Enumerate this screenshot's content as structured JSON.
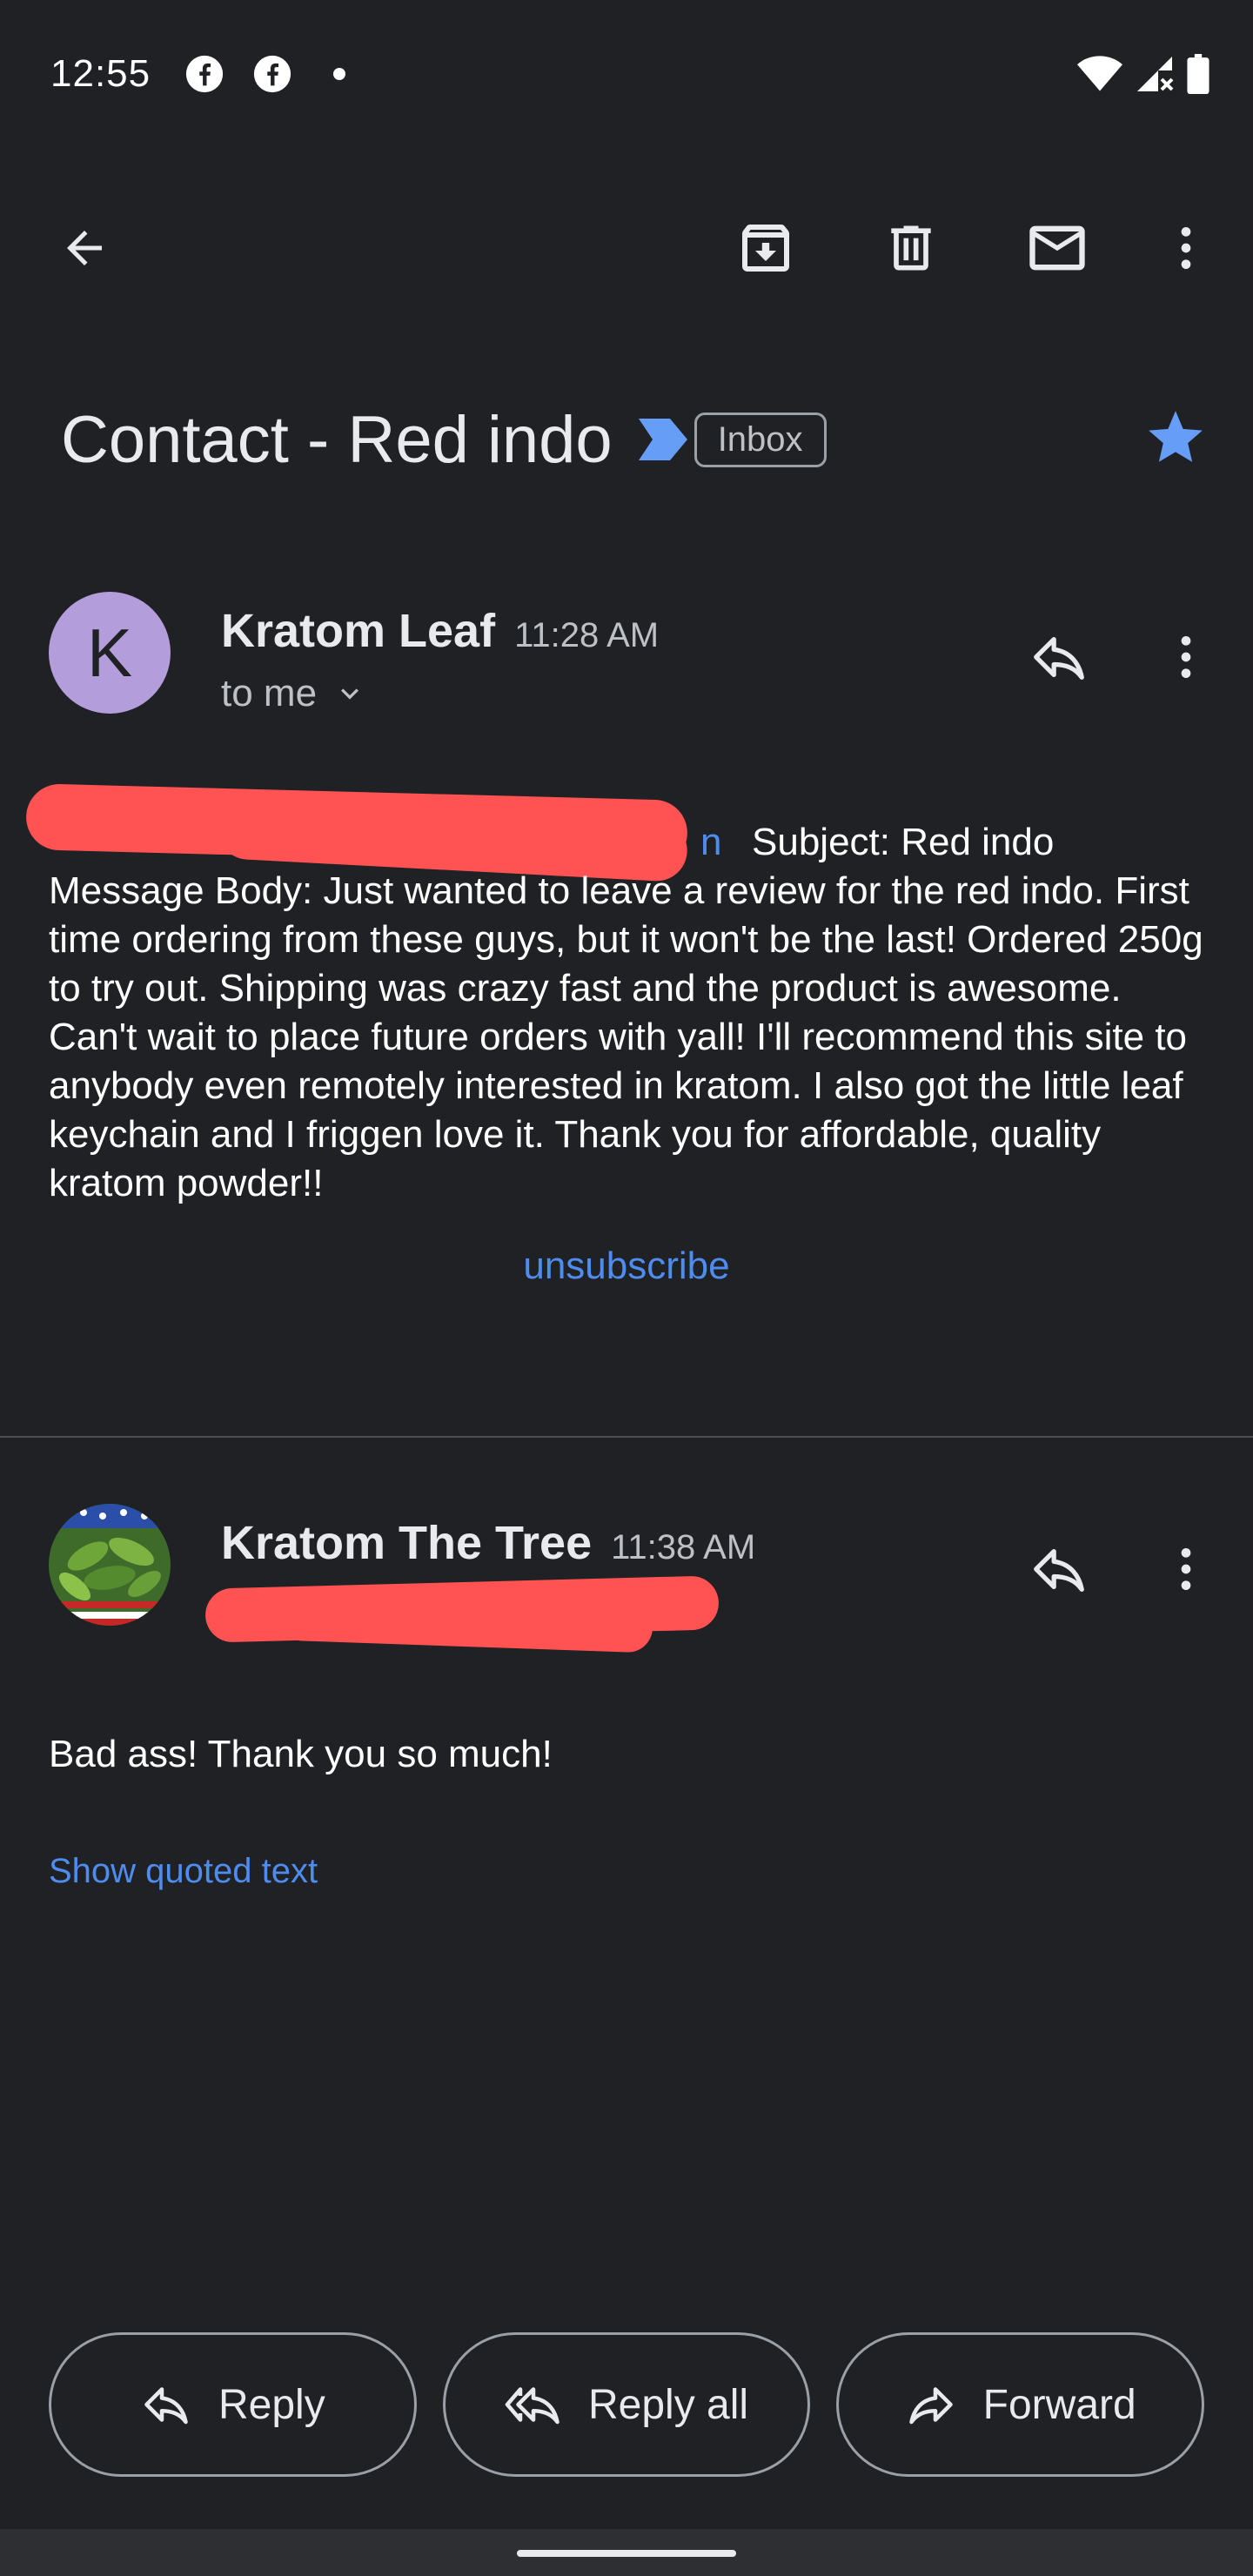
{
  "status_bar": {
    "time": "12:55"
  },
  "toolbar": {
    "back_icon": "arrow-back-icon",
    "archive_icon": "archive-icon",
    "delete_icon": "trash-icon",
    "mark_unread_icon": "mail-icon",
    "more_icon": "more-vert-icon"
  },
  "thread": {
    "subject": "Contact - Red indo",
    "label": "Inbox",
    "starred": true,
    "star_color": "#669df6"
  },
  "messages": [
    {
      "avatar_letter": "K",
      "avatar_color": "#b39ddb",
      "sender": "Kratom Leaf",
      "time": "11:28 AM",
      "recipient": "to me",
      "body_tail_link": "n",
      "body_subject": "Subject: Red indo",
      "body": "Message Body: Just wanted to leave a review for the red indo. First time ordering from these guys, but it won't be the last! Ordered 250g to try out. Shipping was crazy fast and the product is awesome. Can't wait to place future orders with yall! I'll recommend this site to anybody even remotely interested in kratom. I also got the little leaf keychain and I friggen love it. Thank you for affordable, quality kratom powder!!",
      "unsubscribe": "unsubscribe"
    },
    {
      "sender": "Kratom The Tree",
      "time": "11:38 AM",
      "body": "Bad ass! Thank you so much!",
      "show_quoted": "Show quoted text"
    }
  ],
  "actions": {
    "reply": "Reply",
    "reply_all": "Reply all",
    "forward": "Forward"
  },
  "colors": {
    "background": "#202124",
    "link": "#4e8cf0",
    "redaction": "#ff5252",
    "importance": "#669df6"
  }
}
